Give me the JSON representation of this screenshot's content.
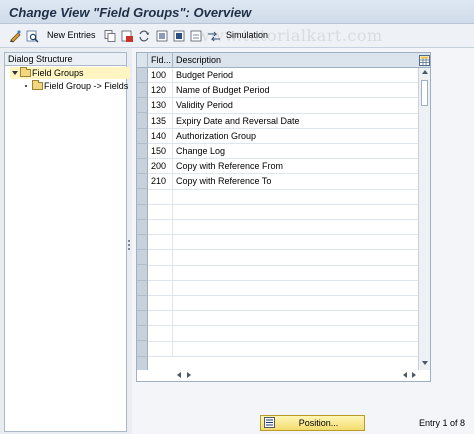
{
  "window": {
    "title": "Change View \"Field Groups\": Overview"
  },
  "toolbar": {
    "new_entries_label": "New Entries",
    "simulation_label": "Simulation",
    "watermark": "www.tutorialkart.com"
  },
  "dialog_structure": {
    "header": "Dialog Structure",
    "items": [
      {
        "label": "Field Groups",
        "level": 0,
        "selected": true,
        "expanded": true
      },
      {
        "label": "Field Group -> Fields",
        "level": 1,
        "selected": false,
        "expanded": false
      }
    ]
  },
  "table": {
    "columns": [
      "Fld...",
      "Description"
    ],
    "rows": [
      {
        "code": "100",
        "description": "Budget Period"
      },
      {
        "code": "120",
        "description": "Name of Budget Period"
      },
      {
        "code": "130",
        "description": "Validity Period"
      },
      {
        "code": "135",
        "description": "Expiry Date and Reversal Date"
      },
      {
        "code": "140",
        "description": "Authorization Group"
      },
      {
        "code": "150",
        "description": "Change Log"
      },
      {
        "code": "200",
        "description": "Copy with Reference From"
      },
      {
        "code": "210",
        "description": "Copy with Reference To"
      }
    ],
    "empty_rows": 11
  },
  "footer": {
    "position_label": "Position...",
    "entry_info": "Entry 1 of 8"
  },
  "colors": {
    "title_text": "#1f2f46",
    "selected_tree_bg": "#fff5c2",
    "position_button": "#f3dc6f"
  }
}
